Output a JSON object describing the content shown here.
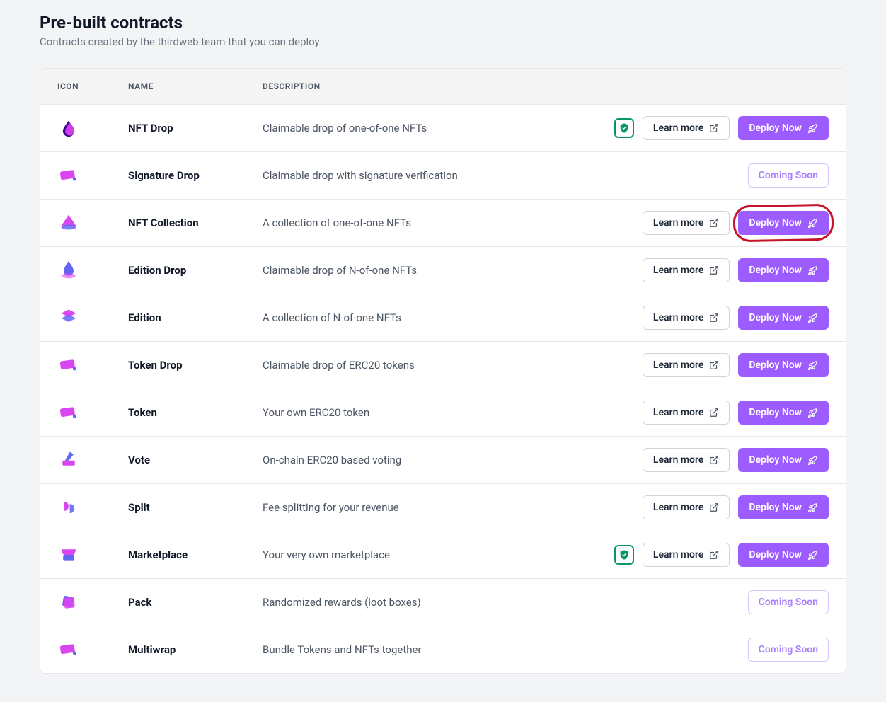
{
  "header": {
    "title": "Pre-built contracts",
    "subtitle": "Contracts created by the thirdweb team that you can deploy"
  },
  "columns": {
    "icon": "ICON",
    "name": "NAME",
    "description": "DESCRIPTION"
  },
  "buttons": {
    "learn_more": "Learn more",
    "deploy_now": "Deploy Now",
    "coming_soon": "Coming Soon"
  },
  "colors": {
    "accent": "#9d5cff",
    "badge_border": "#059669",
    "highlight": "#c4162b"
  },
  "highlight_row_index": 2,
  "contracts": [
    {
      "name": "NFT Drop",
      "description": "Claimable drop of one-of-one NFTs",
      "icon": "drop",
      "audited": true,
      "learn_more": true,
      "deploy": true,
      "coming_soon": false
    },
    {
      "name": "Signature Drop",
      "description": "Claimable drop with signature verification",
      "icon": "signature",
      "audited": false,
      "learn_more": false,
      "deploy": false,
      "coming_soon": true
    },
    {
      "name": "NFT Collection",
      "description": "A collection of one-of-one NFTs",
      "icon": "collection",
      "audited": false,
      "learn_more": true,
      "deploy": true,
      "coming_soon": false
    },
    {
      "name": "Edition Drop",
      "description": "Claimable drop of N-of-one NFTs",
      "icon": "edition-drop",
      "audited": false,
      "learn_more": true,
      "deploy": true,
      "coming_soon": false
    },
    {
      "name": "Edition",
      "description": "A collection of N-of-one NFTs",
      "icon": "edition",
      "audited": false,
      "learn_more": true,
      "deploy": true,
      "coming_soon": false
    },
    {
      "name": "Token Drop",
      "description": "Claimable drop of ERC20 tokens",
      "icon": "token-drop",
      "audited": false,
      "learn_more": true,
      "deploy": true,
      "coming_soon": false
    },
    {
      "name": "Token",
      "description": "Your own ERC20 token",
      "icon": "token",
      "audited": false,
      "learn_more": true,
      "deploy": true,
      "coming_soon": false
    },
    {
      "name": "Vote",
      "description": "On-chain ERC20 based voting",
      "icon": "vote",
      "audited": false,
      "learn_more": true,
      "deploy": true,
      "coming_soon": false
    },
    {
      "name": "Split",
      "description": "Fee splitting for your revenue",
      "icon": "split",
      "audited": false,
      "learn_more": true,
      "deploy": true,
      "coming_soon": false
    },
    {
      "name": "Marketplace",
      "description": "Your very own marketplace",
      "icon": "marketplace",
      "audited": true,
      "learn_more": true,
      "deploy": true,
      "coming_soon": false
    },
    {
      "name": "Pack",
      "description": "Randomized rewards (loot boxes)",
      "icon": "pack",
      "audited": false,
      "learn_more": false,
      "deploy": false,
      "coming_soon": true
    },
    {
      "name": "Multiwrap",
      "description": "Bundle Tokens and NFTs together",
      "icon": "multiwrap",
      "audited": false,
      "learn_more": false,
      "deploy": false,
      "coming_soon": true
    }
  ]
}
